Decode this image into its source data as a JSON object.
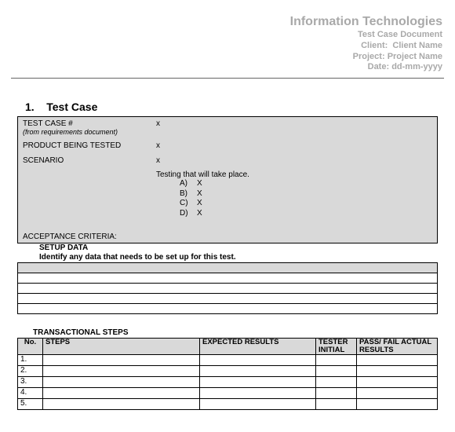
{
  "header": {
    "title": "Information Technologies",
    "line1": "Test Case Document",
    "client_label": "Client:",
    "client_value": "Client Name",
    "project_label": "Project:",
    "project_value": "Project Name",
    "date_label": "Date:",
    "date_value": "dd-mm-yyyy"
  },
  "section": {
    "number": "1.",
    "title": "Test Case"
  },
  "fields": {
    "test_case_num_label": "TEST CASE #",
    "test_case_num_note": "(from requirements  document)",
    "test_case_num_value": "x",
    "product_label": "PRODUCT BEING TESTED",
    "product_value": "x",
    "scenario_label": "SCENARIO",
    "scenario_value": "x",
    "scenario_desc": "Testing that will take place.",
    "scenario_items": [
      {
        "letter": "A)",
        "text": "X"
      },
      {
        "letter": "B)",
        "text": "X"
      },
      {
        "letter": "C)",
        "text": "X"
      },
      {
        "letter": "D)",
        "text": "X"
      }
    ],
    "acceptance_label": "ACCEPTANCE CRITERIA:"
  },
  "setup": {
    "title": "SETUP DATA",
    "desc": "Identify any data that needs to be set up for this test."
  },
  "transactional": {
    "title": "TRANSACTIONAL STEPS",
    "cols": {
      "no": "No.",
      "steps": "STEPS",
      "expected": "EXPECTED RESULTS",
      "tester": "TESTER INITIAL",
      "passfail": "PASS/ FAIL ACTUAL RESULTS"
    },
    "rows": [
      {
        "no": "1."
      },
      {
        "no": "2."
      },
      {
        "no": "3."
      },
      {
        "no": "4."
      },
      {
        "no": "5."
      }
    ]
  }
}
